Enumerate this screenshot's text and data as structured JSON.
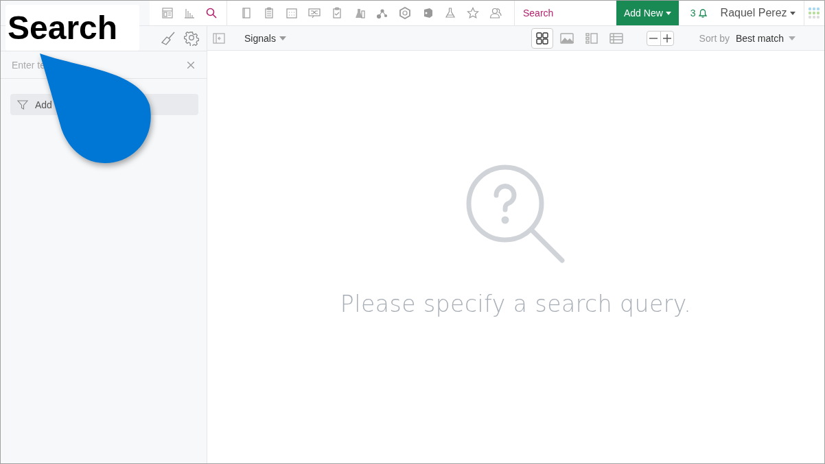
{
  "callout": {
    "label": "Search"
  },
  "nav_views": [
    {
      "kind": "dashboard",
      "selected": false
    },
    {
      "kind": "chart",
      "selected": false
    },
    {
      "kind": "search",
      "selected": true
    }
  ],
  "search_field": {
    "placeholder": "Search"
  },
  "add_new": {
    "label": "Add New"
  },
  "notifications": {
    "count": "3"
  },
  "user": {
    "name": "Raquel Perez"
  },
  "sidebar": {
    "filter_field": {
      "placeholder": "Enter te"
    },
    "add_filter": {
      "label": "Add"
    }
  },
  "toolbar": {
    "result_type": "Signals",
    "view_modes": [
      {
        "kind": "grid",
        "selected": true
      },
      {
        "kind": "image",
        "selected": false
      },
      {
        "kind": "list",
        "selected": false
      },
      {
        "kind": "table",
        "selected": false
      }
    ],
    "sort": {
      "label": "Sort by",
      "value": "Best match"
    }
  },
  "empty_state": {
    "message": "Please specify a search query."
  }
}
